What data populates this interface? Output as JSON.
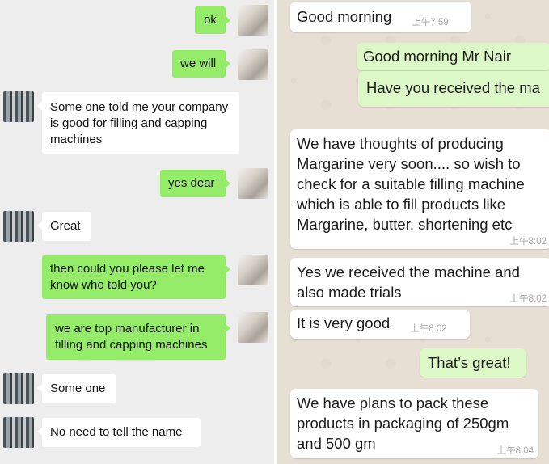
{
  "left_chat": {
    "messages": [
      {
        "from": "me",
        "text": "ok"
      },
      {
        "from": "me",
        "text": "we will"
      },
      {
        "from": "contact",
        "text": "Some one told me your company is good for filling and capping machines"
      },
      {
        "from": "me",
        "text": "yes dear"
      },
      {
        "from": "contact",
        "text": "Great"
      },
      {
        "from": "me",
        "text": "then could you please let me know who told you?"
      },
      {
        "from": "me",
        "text": "we are top manufacturer in filling and capping machines"
      },
      {
        "from": "contact",
        "text": "Some one"
      },
      {
        "from": "contact",
        "text": "No need to tell the name"
      }
    ]
  },
  "right_chat": {
    "messages": [
      {
        "direction": "in",
        "text": "Good morning",
        "time": "上午7:59"
      },
      {
        "direction": "out",
        "text": "Good morning Mr Nair"
      },
      {
        "direction": "out",
        "text": "Have you received the ma"
      },
      {
        "direction": "in",
        "text": "We have thoughts of producing Margarine very soon.... so wish to check for a suitable filling machine which is able to fill products like Margarine, butter, shortening etc",
        "time": "上午8:02"
      },
      {
        "direction": "in",
        "text": "Yes we received the machine and also made trials",
        "time": "上午8:02"
      },
      {
        "direction": "in",
        "text": "It is very good",
        "time": "上午8:02"
      },
      {
        "direction": "out",
        "text": "That’s great!"
      },
      {
        "direction": "in",
        "text": "We have plans to pack these products in packaging of 250gm and 500 gm",
        "time": "上午8:04"
      }
    ]
  },
  "colors": {
    "wechat_sent_bubble": "#95ec69",
    "wechat_background": "#ededed",
    "whatsapp_outgoing_bubble": "#dcf8c6",
    "whatsapp_background": "#e7dfd4"
  }
}
